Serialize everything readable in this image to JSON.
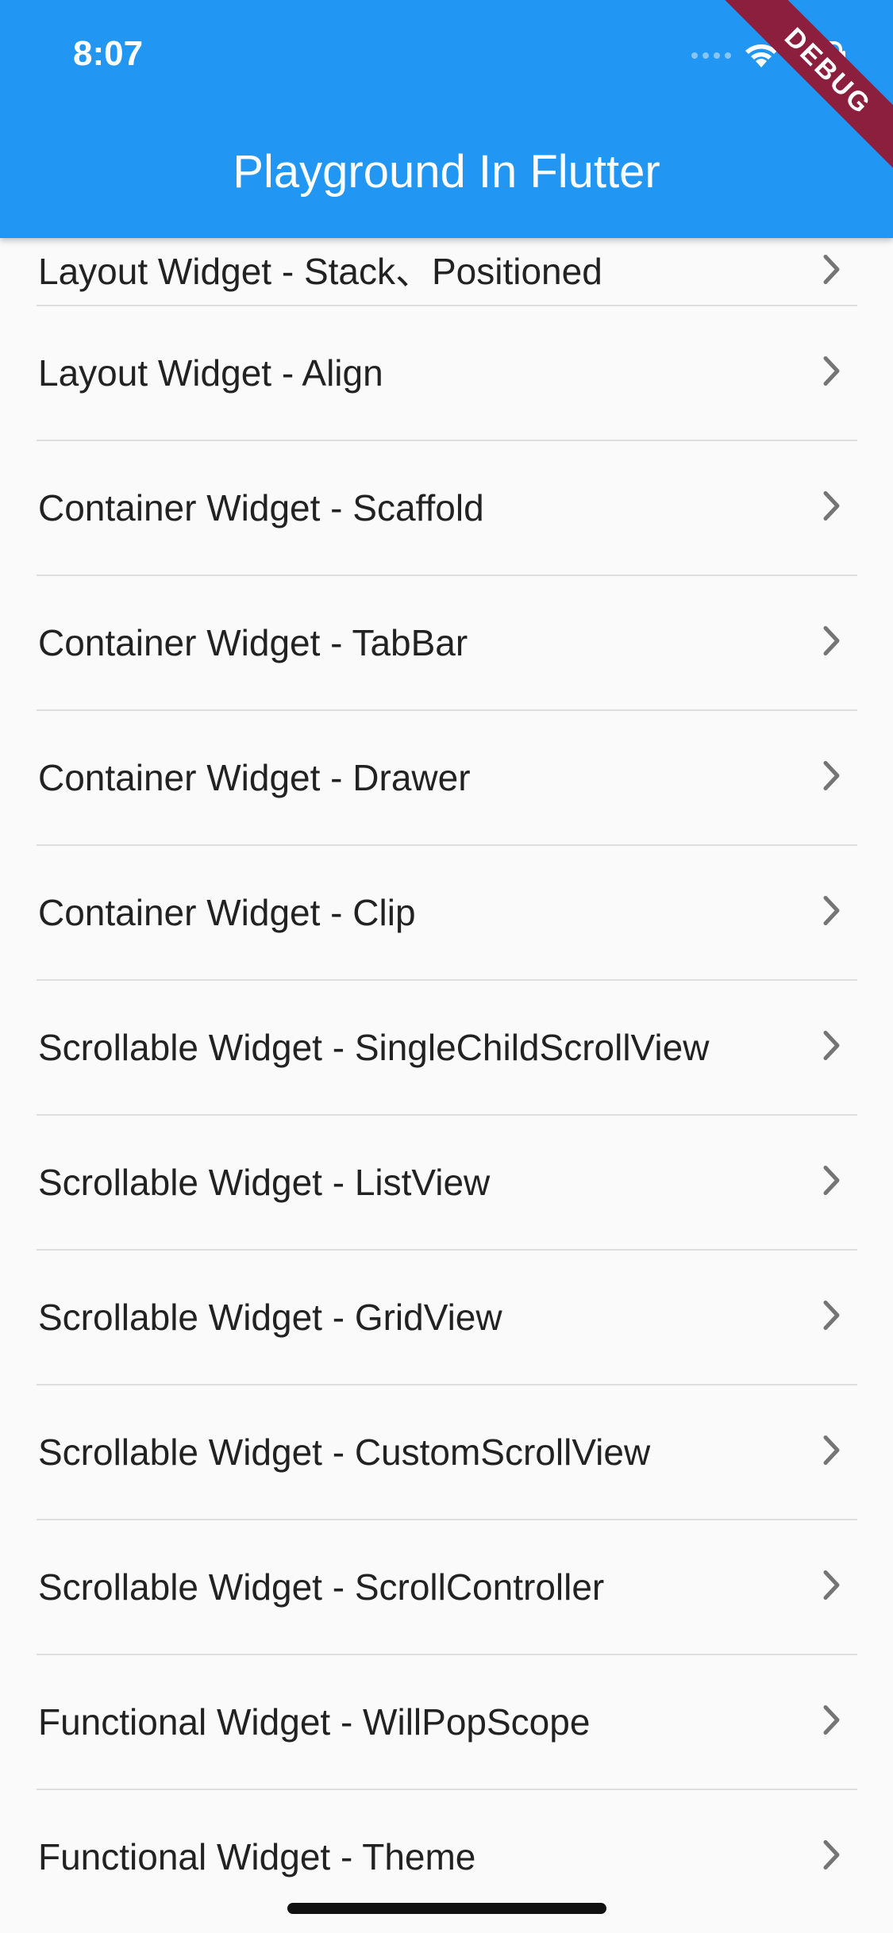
{
  "status_bar": {
    "time": "8:07"
  },
  "app_bar": {
    "title": "Playground In Flutter"
  },
  "debug_banner": "DEBUG",
  "list": {
    "items": [
      {
        "label": "Layout Widget - Stack、Positioned"
      },
      {
        "label": "Layout Widget - Align"
      },
      {
        "label": "Container Widget - Scaffold"
      },
      {
        "label": "Container Widget - TabBar"
      },
      {
        "label": "Container Widget - Drawer"
      },
      {
        "label": "Container Widget - Clip"
      },
      {
        "label": "Scrollable Widget - SingleChildScrollView"
      },
      {
        "label": "Scrollable Widget - ListView"
      },
      {
        "label": "Scrollable Widget - GridView"
      },
      {
        "label": "Scrollable Widget - CustomScrollView"
      },
      {
        "label": "Scrollable Widget - ScrollController"
      },
      {
        "label": "Functional Widget - WillPopScope"
      },
      {
        "label": "Functional Widget - Theme"
      }
    ]
  },
  "icons": {
    "trailing": "chevron-right-icon",
    "status": [
      "signal-dots-icon",
      "wifi-icon",
      "battery-icon"
    ]
  },
  "colors": {
    "app_bar": "#2196f3",
    "debug_banner": "#8b1f3d",
    "background": "#fafafa",
    "divider": "#dedede",
    "chevron": "#757575"
  }
}
